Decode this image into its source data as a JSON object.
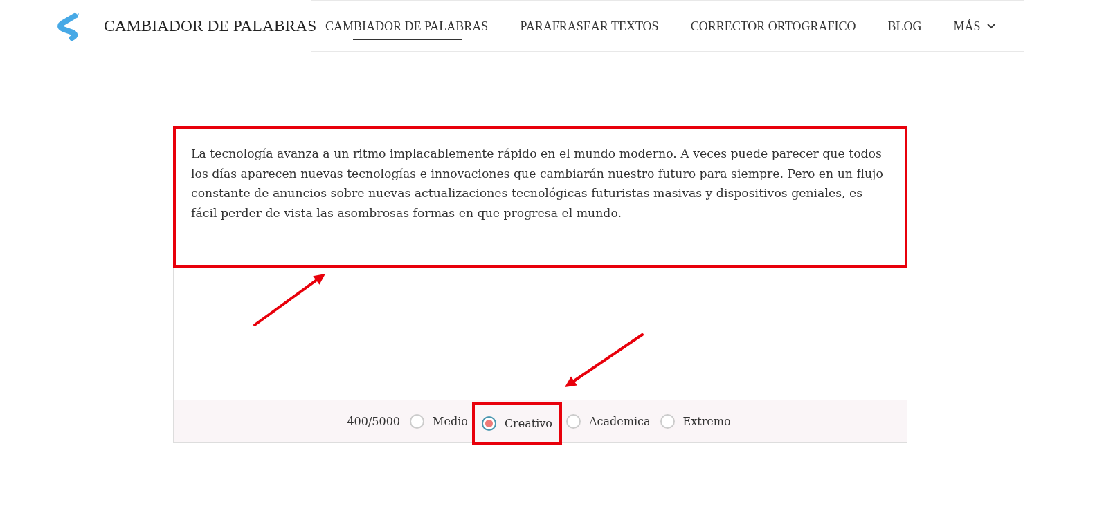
{
  "brand": {
    "title": "CAMBIADOR DE PALABRAS"
  },
  "nav": [
    {
      "label": "CAMBIADOR DE PALABRAS",
      "selected": true,
      "kind": "link"
    },
    {
      "label": "PARAFRASEAR TEXTOS",
      "selected": false,
      "kind": "link"
    },
    {
      "label": "CORRECTOR ORTOGRAFICO",
      "selected": false,
      "kind": "link"
    },
    {
      "label": "BLOG",
      "selected": false,
      "kind": "link"
    },
    {
      "label": "MÁS",
      "selected": false,
      "kind": "dropdown"
    }
  ],
  "editor": {
    "value": "La tecnología avanza a un ritmo implacablemente rápido en el mundo moderno. A veces puede parecer que todos los días aparecen nuevas tecnologías e innovaciones que cambiarán nuestro futuro para siempre. Pero en un flujo constante de anuncios sobre nuevas actualizaciones tecnológicas futuristas masivas y dispositivos geniales, es fácil perder de vista las asombrosas formas en que progresa el mundo.",
    "highlighted": true
  },
  "counter": "400/5000",
  "modes": [
    {
      "label": "Medio",
      "selected": false,
      "highlighted": false
    },
    {
      "label": "Creativo",
      "selected": true,
      "highlighted": true
    },
    {
      "label": "Academica",
      "selected": false,
      "highlighted": false
    },
    {
      "label": "Extremo",
      "selected": false,
      "highlighted": false
    }
  ]
}
